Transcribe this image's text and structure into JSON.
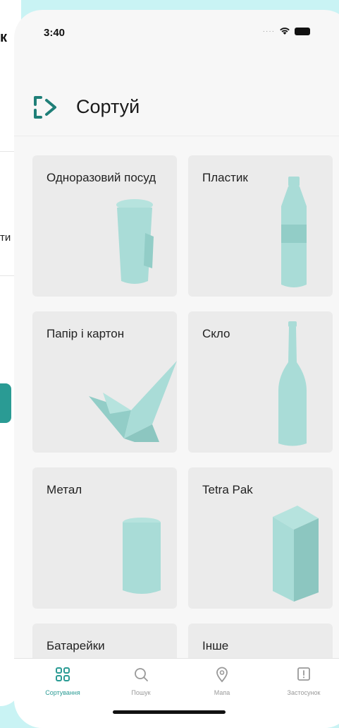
{
  "left_screen": {
    "edge_title": "к",
    "edge_text": "ти"
  },
  "status_bar": {
    "time": "3:40"
  },
  "header": {
    "title": "Сортуй",
    "logo_icon": "recycle-arrows-icon"
  },
  "categories": [
    {
      "label": "Одноразовий посуд",
      "icon": "disposable-cup-icon"
    },
    {
      "label": "Пластик",
      "icon": "plastic-bottle-icon"
    },
    {
      "label": "Папір і картон",
      "icon": "paper-crane-icon"
    },
    {
      "label": "Скло",
      "icon": "glass-bottle-icon"
    },
    {
      "label": "Метал",
      "icon": "metal-can-icon"
    },
    {
      "label": "Tetra Pak",
      "icon": "tetra-pak-carton-icon"
    },
    {
      "label": "Батарейки",
      "icon": "battery-icon"
    },
    {
      "label": "Інше",
      "icon": "other-icon"
    }
  ],
  "tab_bar": {
    "tabs": [
      {
        "label": "Сортування",
        "icon": "grid-icon",
        "active": true
      },
      {
        "label": "Пошук",
        "icon": "search-icon",
        "active": false
      },
      {
        "label": "Мапа",
        "icon": "map-pin-icon",
        "active": false
      },
      {
        "label": "Застосунок",
        "icon": "info-icon",
        "active": false
      }
    ]
  },
  "colors": {
    "accent": "#2a9b94",
    "object_tint": "#a9dcd7",
    "background": "#c9f3f4",
    "card": "#ebebeb"
  }
}
